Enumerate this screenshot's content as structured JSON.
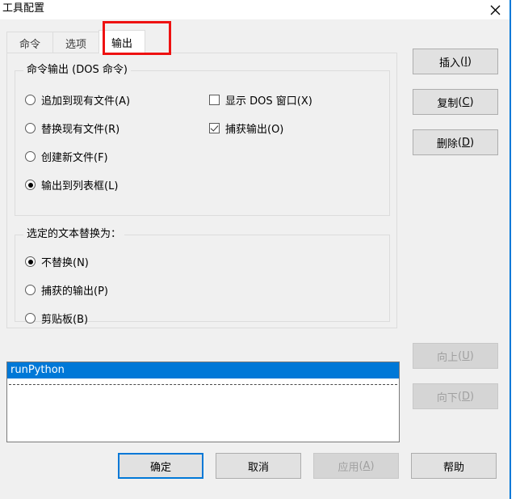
{
  "window": {
    "title": "工具配置",
    "close_icon": "close-icon"
  },
  "tabs": [
    {
      "label": "命令",
      "active": false
    },
    {
      "label": "选项",
      "active": false
    },
    {
      "label": "输出",
      "active": true
    }
  ],
  "groups": {
    "command_output": {
      "title": "命令输出 (DOS 命令)",
      "radios": [
        {
          "label": "追加到现有文件(A)",
          "checked": false
        },
        {
          "label": "替换现有文件(R)",
          "checked": false
        },
        {
          "label": "创建新文件(F)",
          "checked": false
        },
        {
          "label": "输出到列表框(L)",
          "checked": true
        }
      ],
      "checkboxes": [
        {
          "label": "显示 DOS 窗口(X)",
          "checked": false
        },
        {
          "label": "捕获输出(O)",
          "checked": true
        }
      ]
    },
    "text_replace": {
      "title": "选定的文本替换为：",
      "radios": [
        {
          "label": "不替换(N)",
          "checked": true
        },
        {
          "label": "捕获的输出(P)",
          "checked": false
        },
        {
          "label": "剪贴板(B)",
          "checked": false
        }
      ]
    }
  },
  "side_buttons": [
    {
      "label": "插入",
      "mnemonic": "I",
      "disabled": false
    },
    {
      "label": "复制",
      "mnemonic": "C",
      "disabled": false
    },
    {
      "label": "删除",
      "mnemonic": "D",
      "disabled": false
    }
  ],
  "move_buttons": [
    {
      "label": "向上",
      "mnemonic": "U",
      "disabled": true
    },
    {
      "label": "向下",
      "mnemonic": "D",
      "disabled": true
    }
  ],
  "listbox": {
    "items": [
      {
        "text": "runPython",
        "selected": true
      }
    ]
  },
  "bottom_buttons": [
    {
      "label": "确定",
      "mnemonic": "",
      "disabled": false,
      "default": true
    },
    {
      "label": "取消",
      "mnemonic": "",
      "disabled": false,
      "default": false
    },
    {
      "label": "应用",
      "mnemonic": "A",
      "disabled": true,
      "default": false
    },
    {
      "label": "帮助",
      "mnemonic": "",
      "disabled": false,
      "default": false
    }
  ],
  "annotation": {
    "color": "#ee1111",
    "target": "输出"
  }
}
